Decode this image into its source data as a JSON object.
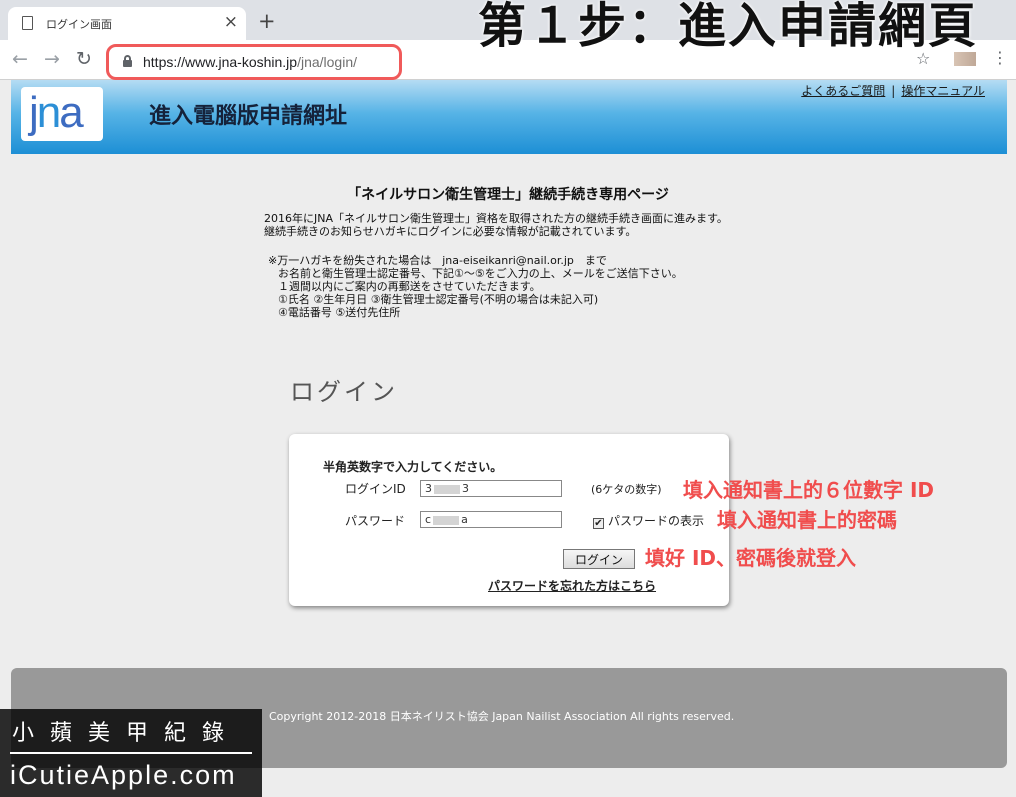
{
  "browser": {
    "tab_title": "ログイン画面",
    "tab_close": "×",
    "new_tab": "+",
    "url_host": "https://www.jna-koshin.jp",
    "url_path": "/jna/login/",
    "back_glyph": "←",
    "forward_glyph": "→",
    "reload_glyph": "↻",
    "star_glyph": "☆",
    "menu_glyph": "⋮"
  },
  "overlay_heading": "第１步：進入申請網頁",
  "header": {
    "logo_j": "j",
    "logo_n": "n",
    "logo_a": "a",
    "title": "進入電腦版申請網址",
    "faq_link": "よくあるご質問",
    "separator": "|",
    "manual_link": "操作マニュアル"
  },
  "content": {
    "heading": "「ネイルサロン衛生管理士」継続手続き専用ページ",
    "intro_line1": "2016年にJNA「ネイルサロン衛生管理士」資格を取得された方の継続手続き画面に進みます。",
    "intro_line2": "継続手続きのお知らせハガキにログインに必要な情報が記載されています。",
    "notice_line1": "※万一ハガキを紛失された場合は　jna-eiseikanri@nail.or.jp　まで",
    "notice_line2": "お名前と衛生管理士認定番号、下記①〜⑤をご入力の上、メールをご送信下さい。",
    "notice_line3": "１週間以内にご案内の再郵送をさせていただきます。",
    "notice_line4": "①氏名 ②生年月日 ③衛生管理士認定番号(不明の場合は未記入可)",
    "notice_line5": "④電話番号 ⑤送付先住所"
  },
  "login": {
    "heading": "ログイン",
    "instruction": "半角英数字で入力してください。",
    "id_label": "ログインID",
    "id_value_start": "3",
    "id_value_end": "3",
    "id_hint": "(6ケタの数字)",
    "password_label": "パスワード",
    "password_value_start": "c",
    "password_value_end": "a",
    "show_password_label": "パスワードの表示",
    "show_password_checked": "✔",
    "login_button": "ログイン",
    "forgot_link": "パスワードを忘れた方はこちら"
  },
  "annotations": {
    "id_note": "填入通知書上的６位數字 ID",
    "password_note": "填入通知書上的密碼",
    "login_note": "填好 ID、密碼後就登入",
    "color": "#f04d4d"
  },
  "footer": {
    "copyright": "Copyright 2012-2018 日本ネイリスト協会 Japan Nailist Association All rights reserved."
  },
  "watermark": {
    "chinese": "小蘋美甲紀錄",
    "english": "iCutieApple.com"
  },
  "colors": {
    "header_blue": "#1d8fd5",
    "highlight_red": "#f05a5a",
    "footer_gray": "#999999"
  }
}
